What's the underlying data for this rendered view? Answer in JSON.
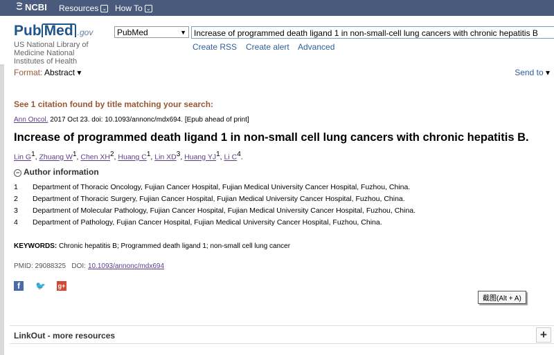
{
  "topbar": {
    "brand": "NCBI",
    "resources_label": "Resources",
    "howto_label": "How To"
  },
  "header": {
    "logo_pub": "Pub",
    "logo_med": "Med",
    "logo_gov": ".gov",
    "nlm_text": "US National Library of Medicine National Institutes of Health",
    "database_select": "PubMed",
    "search_value": "Increase of programmed death ligand 1 in non-small-cell lung cancers with chronic hepatitis B",
    "links": [
      "Create RSS",
      "Create alert",
      "Advanced"
    ]
  },
  "format": {
    "label": "Format:",
    "value": "Abstract",
    "send_to": "Send to"
  },
  "article": {
    "found_text": "See 1 citation found by title matching your search:",
    "journal": "Ann Oncol.",
    "citation_rest": " 2017 Oct 23. doi: 10.1093/annonc/mdx694. [Epub ahead of print]",
    "title": "Increase of programmed death ligand 1 in non-small cell lung cancers with chronic hepatitis B.",
    "authors": [
      {
        "name": "Lin G",
        "aff": "1"
      },
      {
        "name": "Zhuang W",
        "aff": "1"
      },
      {
        "name": "Chen XH",
        "aff": "2"
      },
      {
        "name": "Huang C",
        "aff": "1"
      },
      {
        "name": "Lin XD",
        "aff": "3"
      },
      {
        "name": "Huang YJ",
        "aff": "1"
      },
      {
        "name": "Li C",
        "aff": "4"
      }
    ],
    "author_info_label": "Author information",
    "affiliations": [
      {
        "num": "1",
        "text": "Department of Thoracic Oncology, Fujian Cancer Hospital, Fujian Medical University Cancer Hospital, Fuzhou, China."
      },
      {
        "num": "2",
        "text": "Department of Thoracic Surgery, Fujian Cancer Hospital, Fujian Medical University Cancer Hospital, Fuzhou, China."
      },
      {
        "num": "3",
        "text": "Department of Molecular Pathology, Fujian Cancer Hospital, Fujian Medical University Cancer Hospital, Fuzhou, China."
      },
      {
        "num": "4",
        "text": "Department of Pathology, Fujian Cancer Hospital, Fujian Medical University Cancer Hospital, Fuzhou, China."
      }
    ],
    "keywords_label": "KEYWORDS:",
    "keywords": " Chronic hepatitis B; Programmed death ligand 1; non-small cell lung cancer",
    "pmid": "PMID: 29088325",
    "doi_label": "DOI:",
    "doi": "10.1093/annonc/mdx694"
  },
  "share": {
    "facebook": "f",
    "twitter": "🐦",
    "google": "g+"
  },
  "tooltip": "截图(Alt + A)",
  "linkout": {
    "label": "LinkOut - more resources",
    "expand": "+"
  }
}
